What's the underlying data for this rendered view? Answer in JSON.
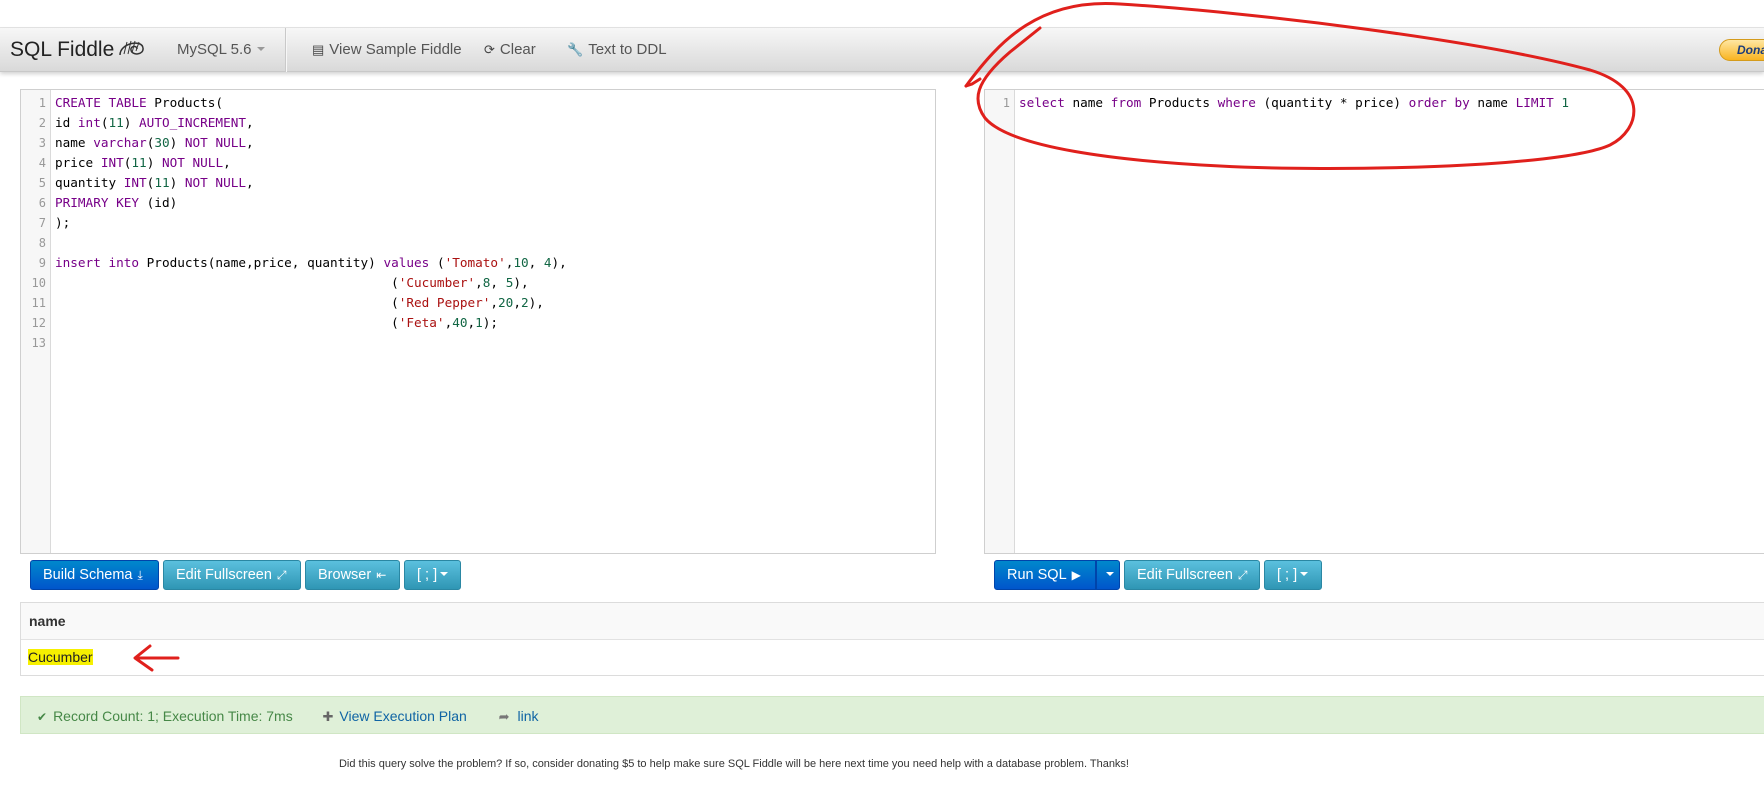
{
  "app": {
    "brand": "SQL Fiddle",
    "db_version": "MySQL 5.6",
    "nav": {
      "view_sample": "View Sample Fiddle",
      "clear": "Clear",
      "text_to_ddl": "Text to DDL",
      "donate": "Donate"
    }
  },
  "schema_editor": {
    "line_numbers": [
      "1",
      "2",
      "3",
      "4",
      "5",
      "6",
      "7",
      "8",
      "9",
      "10",
      "11",
      "12",
      "13"
    ],
    "lines": [
      [
        {
          "t": "CREATE TABLE",
          "c": "kw"
        },
        {
          "t": " Products(",
          "c": ""
        }
      ],
      [
        {
          "t": "id ",
          "c": ""
        },
        {
          "t": "int",
          "c": "kw"
        },
        {
          "t": "(",
          "c": ""
        },
        {
          "t": "11",
          "c": "nm"
        },
        {
          "t": ") ",
          "c": ""
        },
        {
          "t": "AUTO_INCREMENT",
          "c": "kw"
        },
        {
          "t": ",",
          "c": ""
        }
      ],
      [
        {
          "t": "name ",
          "c": ""
        },
        {
          "t": "varchar",
          "c": "kw"
        },
        {
          "t": "(",
          "c": ""
        },
        {
          "t": "30",
          "c": "nm"
        },
        {
          "t": ") ",
          "c": ""
        },
        {
          "t": "NOT NULL",
          "c": "kw"
        },
        {
          "t": ",",
          "c": ""
        }
      ],
      [
        {
          "t": "price ",
          "c": ""
        },
        {
          "t": "INT",
          "c": "kw"
        },
        {
          "t": "(",
          "c": ""
        },
        {
          "t": "11",
          "c": "nm"
        },
        {
          "t": ") ",
          "c": ""
        },
        {
          "t": "NOT NULL",
          "c": "kw"
        },
        {
          "t": ",",
          "c": ""
        }
      ],
      [
        {
          "t": "quantity ",
          "c": ""
        },
        {
          "t": "INT",
          "c": "kw"
        },
        {
          "t": "(",
          "c": ""
        },
        {
          "t": "11",
          "c": "nm"
        },
        {
          "t": ") ",
          "c": ""
        },
        {
          "t": "NOT NULL",
          "c": "kw"
        },
        {
          "t": ",",
          "c": ""
        }
      ],
      [
        {
          "t": "PRIMARY KEY",
          "c": "kw"
        },
        {
          "t": " (id)",
          "c": ""
        }
      ],
      [
        {
          "t": ");",
          "c": ""
        }
      ],
      [],
      [
        {
          "t": "insert into",
          "c": "kw"
        },
        {
          "t": " Products(name,price, quantity) ",
          "c": ""
        },
        {
          "t": "values",
          "c": "kw"
        },
        {
          "t": " (",
          "c": ""
        },
        {
          "t": "'Tomato'",
          "c": "st"
        },
        {
          "t": ",",
          "c": ""
        },
        {
          "t": "10",
          "c": "nm"
        },
        {
          "t": ", ",
          "c": ""
        },
        {
          "t": "4",
          "c": "nm"
        },
        {
          "t": "),",
          "c": ""
        }
      ],
      [
        {
          "t": "                                            (",
          "c": ""
        },
        {
          "t": "'Cucumber'",
          "c": "st"
        },
        {
          "t": ",",
          "c": ""
        },
        {
          "t": "8",
          "c": "nm"
        },
        {
          "t": ", ",
          "c": ""
        },
        {
          "t": "5",
          "c": "nm"
        },
        {
          "t": "),",
          "c": ""
        }
      ],
      [
        {
          "t": "                                            (",
          "c": ""
        },
        {
          "t": "'Red Pepper'",
          "c": "st"
        },
        {
          "t": ",",
          "c": ""
        },
        {
          "t": "20",
          "c": "nm"
        },
        {
          "t": ",",
          "c": ""
        },
        {
          "t": "2",
          "c": "nm"
        },
        {
          "t": "),",
          "c": ""
        }
      ],
      [
        {
          "t": "                                            (",
          "c": ""
        },
        {
          "t": "'Feta'",
          "c": "st"
        },
        {
          "t": ",",
          "c": ""
        },
        {
          "t": "40",
          "c": "nm"
        },
        {
          "t": ",",
          "c": ""
        },
        {
          "t": "1",
          "c": "nm"
        },
        {
          "t": ");",
          "c": ""
        }
      ],
      []
    ]
  },
  "query_editor": {
    "line_numbers": [
      "1"
    ],
    "lines": [
      [
        {
          "t": "select",
          "c": "kw"
        },
        {
          "t": " name ",
          "c": ""
        },
        {
          "t": "from",
          "c": "kw"
        },
        {
          "t": " Products ",
          "c": ""
        },
        {
          "t": "where",
          "c": "kw"
        },
        {
          "t": " (quantity * price) ",
          "c": ""
        },
        {
          "t": "order by",
          "c": "kw"
        },
        {
          "t": " name ",
          "c": ""
        },
        {
          "t": "LIMIT",
          "c": "kw"
        },
        {
          "t": " ",
          "c": ""
        },
        {
          "t": "1",
          "c": "nm"
        }
      ]
    ]
  },
  "schema_buttons": {
    "build_schema": "Build Schema",
    "edit_fullscreen": "Edit Fullscreen",
    "browser": "Browser",
    "terminator": "[ ; ]"
  },
  "query_buttons": {
    "run_sql": "Run SQL",
    "edit_fullscreen": "Edit Fullscreen",
    "terminator": "[ ; ]"
  },
  "results": {
    "columns": [
      "name"
    ],
    "rows": [
      [
        "Cucumber"
      ]
    ]
  },
  "status": {
    "summary": "Record Count: 1; Execution Time: 7ms",
    "view_plan": "View Execution Plan",
    "link": "link"
  },
  "footer": {
    "message": "Did this query solve the problem? If so, consider donating $5 to help make sure SQL Fiddle will be here next time you need help with a database problem. Thanks!"
  },
  "annotation_color": "#e0201c",
  "highlight_color": "#f6f000"
}
